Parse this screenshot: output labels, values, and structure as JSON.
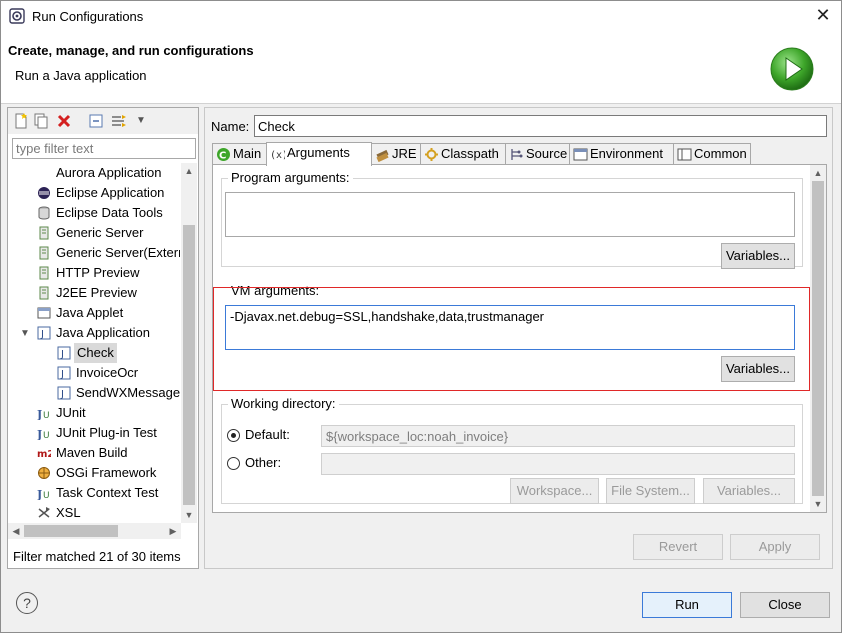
{
  "window": {
    "title": "Run Configurations",
    "close_label": "✕"
  },
  "banner": {
    "heading": "Create, manage, and run configurations",
    "subheading": "Run a Java application"
  },
  "left": {
    "filter_placeholder": "type filter text",
    "items": [
      {
        "label": "Aurora Application"
      },
      {
        "label": "Eclipse Application"
      },
      {
        "label": "Eclipse Data Tools"
      },
      {
        "label": "Generic Server"
      },
      {
        "label": "Generic Server(Extern"
      },
      {
        "label": "HTTP Preview"
      },
      {
        "label": "J2EE Preview"
      },
      {
        "label": "Java Applet"
      },
      {
        "label": "Java Application"
      },
      {
        "label": "Check"
      },
      {
        "label": "InvoiceOcr"
      },
      {
        "label": "SendWXMessage"
      },
      {
        "label": "JUnit"
      },
      {
        "label": "JUnit Plug-in Test"
      },
      {
        "label": "Maven Build"
      },
      {
        "label": "OSGi Framework"
      },
      {
        "label": "Task Context Test"
      },
      {
        "label": "XSL"
      }
    ],
    "status": "Filter matched 21 of 30 items"
  },
  "right": {
    "name_label": "Name:",
    "name_value": "Check",
    "tabs": [
      {
        "label": "Main"
      },
      {
        "label": "Arguments"
      },
      {
        "label": "JRE"
      },
      {
        "label": "Classpath"
      },
      {
        "label": "Source"
      },
      {
        "label": "Environment"
      },
      {
        "label": "Common"
      }
    ],
    "program_args_label": "Program arguments:",
    "program_args_value": "",
    "variables_label": "Variables...",
    "vm_args_label": "VM arguments:",
    "vm_args_value": "-Djavax.net.debug=SSL,handshake,data,trustmanager",
    "working_dir_label": "Working directory:",
    "default_label": "Default:",
    "default_value": "${workspace_loc:noah_invoice}",
    "other_label": "Other:",
    "other_value": "",
    "workspace_button": "Workspace...",
    "filesystem_button": "File System...",
    "revert_button": "Revert",
    "apply_button": "Apply"
  },
  "footer": {
    "help_label": "?",
    "run_button": "Run",
    "close_button": "Close"
  },
  "colors": {
    "highlight_box": "#e02828",
    "focus_border": "#3b7ad8"
  }
}
